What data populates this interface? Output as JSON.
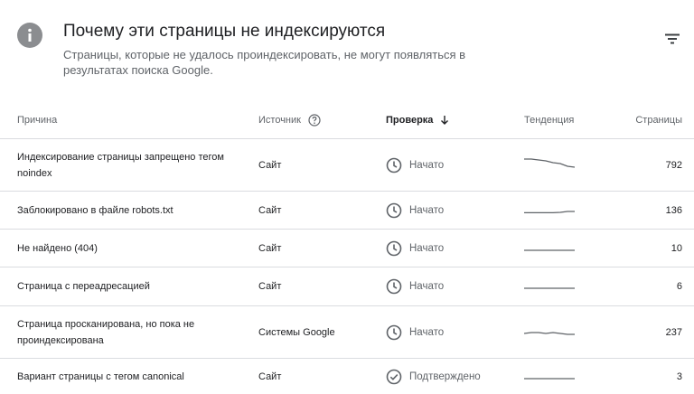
{
  "header": {
    "icon": "info-icon",
    "title": "Почему эти страницы не индексируются",
    "subtitle": "Страницы, которые не удалось проиндексировать, не могут появляться в результатах поиска Google.",
    "filter_icon": "filter-icon"
  },
  "table": {
    "columns": {
      "reason": "Причина",
      "source": "Источник",
      "check": "Проверка",
      "trend": "Тенденция",
      "pages": "Страницы"
    },
    "sort": {
      "column": "check",
      "direction": "descending",
      "icon": "arrow-down-icon"
    },
    "rows": [
      {
        "reason": "Индексирование страницы запрещено тегом noindex",
        "source": "Сайт",
        "check": "Начато",
        "check_icon": "clock-icon",
        "pages": "792",
        "trend": [
          0.15,
          0.15,
          0.2,
          0.25,
          0.35,
          0.4,
          0.55,
          0.6
        ]
      },
      {
        "reason": "Заблокировано в файле robots.txt",
        "source": "Сайт",
        "check": "Начато",
        "check_icon": "clock-icon",
        "pages": "136",
        "trend": [
          0.62,
          0.62,
          0.62,
          0.62,
          0.62,
          0.6,
          0.55,
          0.55
        ]
      },
      {
        "reason": "Не найдено (404)",
        "source": "Сайт",
        "check": "Начато",
        "check_icon": "clock-icon",
        "pages": "10",
        "trend": [
          0.6,
          0.6,
          0.6,
          0.6,
          0.6,
          0.6,
          0.6,
          0.6
        ]
      },
      {
        "reason": "Страница с переадресацией",
        "source": "Сайт",
        "check": "Начато",
        "check_icon": "clock-icon",
        "pages": "6",
        "trend": [
          0.6,
          0.6,
          0.6,
          0.6,
          0.6,
          0.6,
          0.6,
          0.6
        ]
      },
      {
        "reason": "Страница просканирована, но пока не проиндексирована",
        "source": "Системы Google",
        "check": "Начато",
        "check_icon": "clock-icon",
        "pages": "237",
        "trend": [
          0.55,
          0.5,
          0.5,
          0.55,
          0.5,
          0.55,
          0.6,
          0.6
        ]
      },
      {
        "reason": "Вариант страницы с тегом canonical",
        "source": "Сайт",
        "check": "Подтверждено",
        "check_icon": "check-circle-icon",
        "pages": "3",
        "trend": [
          0.6,
          0.6,
          0.6,
          0.6,
          0.6,
          0.6,
          0.6,
          0.6
        ]
      }
    ]
  }
}
